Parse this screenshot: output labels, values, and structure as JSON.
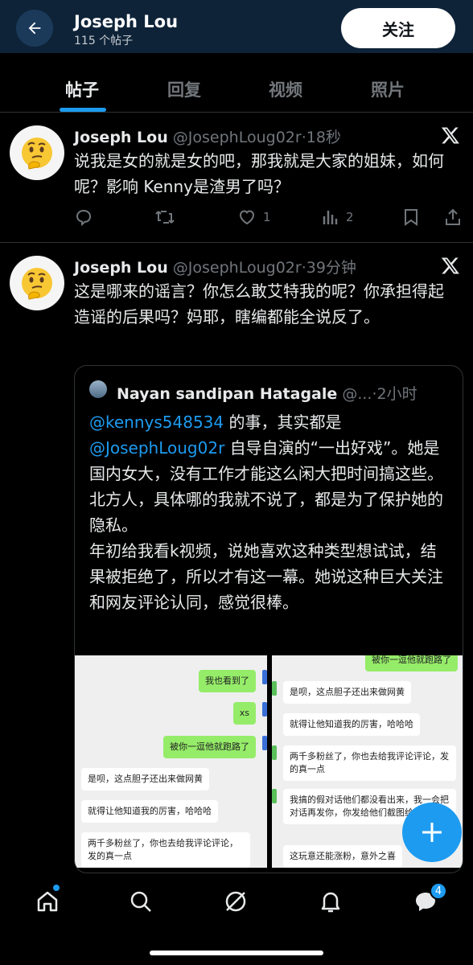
{
  "header": {
    "title": "Joseph Lou",
    "subtitle": "115 个帖子",
    "follow_label": "关注"
  },
  "tabs": [
    {
      "label": "帖子",
      "active": true
    },
    {
      "label": "回复",
      "active": false
    },
    {
      "label": "视频",
      "active": false
    },
    {
      "label": "照片",
      "active": false
    }
  ],
  "tweets": [
    {
      "name": "Joseph Lou",
      "handle": "@JosephLoug02r",
      "time": "·18秒",
      "text": "说我是女的就是女的吧，那我就是大家的姐妹，如何呢？影响 Kenny是渣男了吗？",
      "likes": "1",
      "views": "2",
      "avatar_icon": "thinking-face-emoji"
    },
    {
      "name": "Joseph Lou",
      "handle": "@JosephLoug02r",
      "time": "·39分钟",
      "text": "这是哪来的谣言？你怎么敢艾特我的呢？你承担得起造谣的后果吗？妈耶，瞎编都能全说反了。",
      "avatar_icon": "thinking-face-emoji",
      "quote": {
        "name": "Nayan sandipan Hatagale",
        "handle": "@...",
        "time": "·2小时",
        "mention1": "@kennys548534",
        "text1": " 的事，其实都是",
        "mention2": "@JosephLoug02r",
        "text2": " 自导自演的“一出好戏”。她是国内女大，没有工作才能这么闲大把时间搞这些。",
        "text3": "北方人，具体哪的我就不说了，都是为了保护她的隐私。",
        "text4": "年初给我看k视频，说她喜欢这种类型想试试，结果被拒绝了，所以才有这一幕。她说这种巨大关注和网友评论认同，感觉很棒。",
        "chat_left": [
          {
            "side": "g",
            "text": "我也看到了"
          },
          {
            "side": "g",
            "text": "xs"
          },
          {
            "side": "g",
            "text": "被你一逗他就跑路了"
          },
          {
            "side": "w",
            "text": "是呗，这点胆子还出来做网黄"
          },
          {
            "side": "w",
            "text": "就得让他知道我的厉害，哈哈哈"
          },
          {
            "side": "w",
            "text": "两千多粉丝了，你也去给我评论评论，发的真一点"
          }
        ],
        "chat_right": [
          {
            "side": "g",
            "text": "被你一逗他就跑路了"
          },
          {
            "side": "w",
            "text": "是呗，这点胆子还出来做网黄"
          },
          {
            "side": "w",
            "text": "就得让他知道我的厉害，哈哈哈"
          },
          {
            "side": "w",
            "text": "两千多粉丝了，你也去给我评论评论，发的真一点"
          },
          {
            "side": "w",
            "text": "我搞的假对话他们都没看出来，我一会把对话再发你，你发给他们截图给他们看。"
          },
          {
            "side": "w",
            "text": "这玩意还能涨粉，意外之喜"
          }
        ]
      }
    }
  ],
  "nav": {
    "messages_badge": "4"
  },
  "colors": {
    "accent": "#1d9bf0",
    "background": "#000000",
    "header_bg": "#0e2338",
    "muted": "#71767b"
  }
}
